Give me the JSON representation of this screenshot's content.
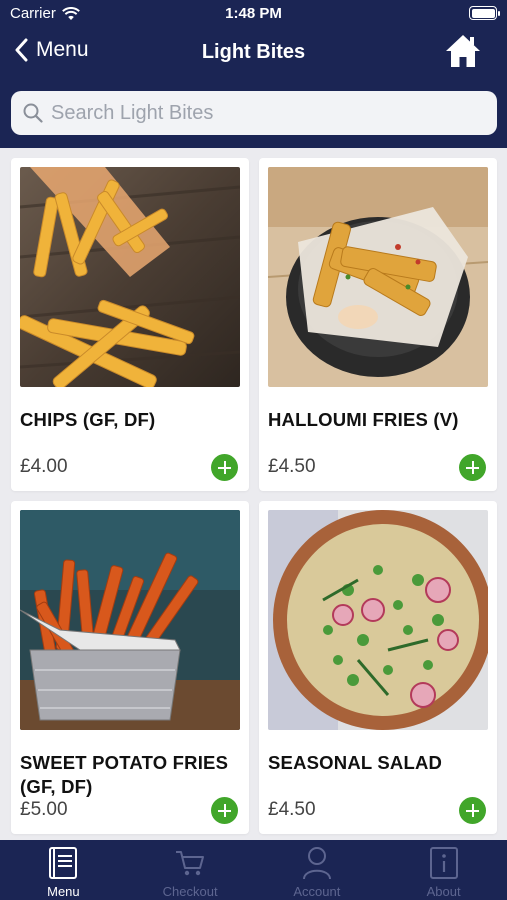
{
  "status_bar": {
    "carrier": "Carrier",
    "time": "1:48 PM"
  },
  "nav": {
    "back_label": "Menu",
    "title": "Light Bites"
  },
  "search": {
    "placeholder": "Search Light Bites",
    "value": ""
  },
  "products": [
    {
      "name": "CHIPS (GF, DF)",
      "price": "£4.00",
      "image": "chips-photo"
    },
    {
      "name": "HALLOUMI FRIES (V)",
      "price": "£4.50",
      "image": "halloumi-fries-photo"
    },
    {
      "name": "SWEET POTATO FRIES (GF, DF)",
      "price": "£5.00",
      "image": "sweet-potato-fries-photo"
    },
    {
      "name": "SEASONAL SALAD",
      "price": "£4.50",
      "image": "seasonal-salad-photo"
    }
  ],
  "tabs": [
    {
      "label": "Menu",
      "icon": "menu-book-icon",
      "active": true
    },
    {
      "label": "Checkout",
      "icon": "cart-icon",
      "active": false
    },
    {
      "label": "Account",
      "icon": "user-icon",
      "active": false
    },
    {
      "label": "About",
      "icon": "info-icon",
      "active": false
    }
  ],
  "colors": {
    "header": "#1b2554",
    "add_button": "#41a62a",
    "background": "#ebebef"
  }
}
